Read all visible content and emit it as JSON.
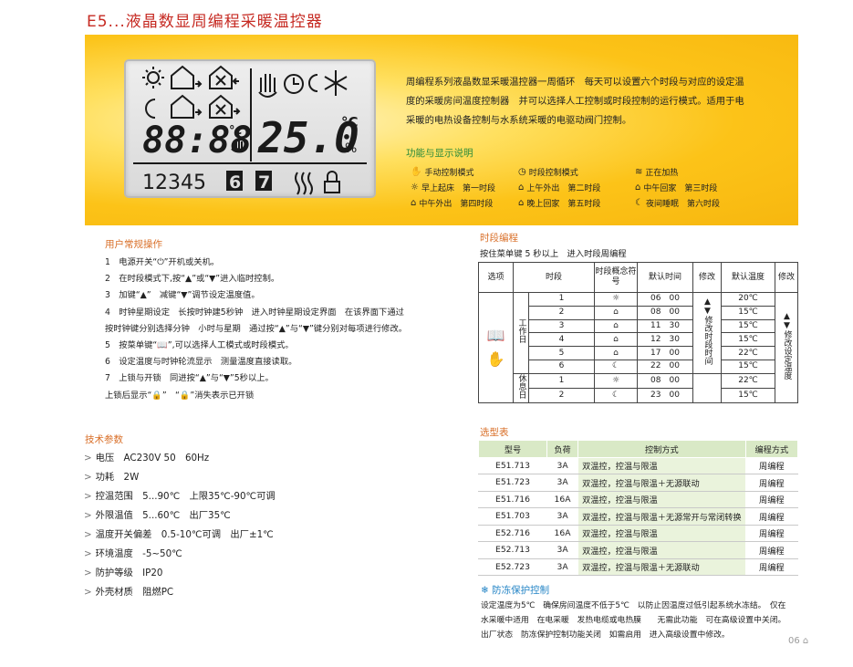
{
  "header": {
    "title": "E5...液晶数显周编程采暖温控器"
  },
  "lcd": {
    "time": "88:88",
    "time_unit": "°c",
    "temp": "25.0",
    "temp_unit": "°C",
    "percent": "%",
    "days": [
      "1",
      "2",
      "3",
      "4",
      "5",
      "6",
      "7"
    ]
  },
  "intro": {
    "text": "周编程系列液晶数显采暖温控器一周循环　每天可以设置六个时段与对应的设定温度的采暖房间温度控制器　并可以选择人工控制或时段控制的运行模式。适用于电采暖的电热设备控制与水系统采暖的电驱动阀门控制。"
  },
  "legend": {
    "heading": "功能与显示说明",
    "items": [
      {
        "icon": "✋",
        "label": "手动控制模式"
      },
      {
        "icon": "◷",
        "label": "时段控制模式"
      },
      {
        "icon": "≋",
        "label": "正在加热"
      },
      {
        "icon": "☼",
        "label": "早上起床　第一时段"
      },
      {
        "icon": "⌂",
        "label": "上午外出　第二时段"
      },
      {
        "icon": "⌂",
        "label": "中午回家　第三时段"
      },
      {
        "icon": "⌂",
        "label": "中午外出　第四时段"
      },
      {
        "icon": "⌂",
        "label": "晚上回家　第五时段"
      },
      {
        "icon": "☾",
        "label": "夜间睡眠　第六时段"
      }
    ]
  },
  "operation": {
    "heading": "用户常规操作",
    "lines": [
      "1　电源开关“⏻”开机或关机。",
      "2　在时段模式下,按“▲”或“▼”进入临时控制。",
      "3　加键“▲”　减键“▼”调节设定温度值。",
      "4　时钟星期设定　长按时钟建5秒钟　进入时钟星期设定界面　在该界面下通过",
      "按时钟键分别选择分钟　小时与星期　通过按“▲”与“▼”键分别对每项进行修改。",
      "5　按菜单键“📖”,可以选择人工模式或时段模式。",
      "6　设定温度与时钟轮流显示　测量温度直接读取。",
      "7　上锁与开锁　同进按“▲”与“▼”5秒以上。",
      "上锁后显示“🔒”　“🔒”消失表示已开锁"
    ]
  },
  "schedule": {
    "heading": "时段编程",
    "subheading": "按住菜单键 5 秒以上　进入时段周编程",
    "headers": [
      "选项",
      "时段",
      "时段概念符号",
      "默认时间",
      "修改",
      "默认温度",
      "修改"
    ],
    "workday_label": "工作日",
    "restday_label": "休息日",
    "modify_time": "▲▼修改时段时间",
    "modify_temp": "▲▼修改设定温度",
    "rows": [
      {
        "n": "1",
        "icon": "☼",
        "time": "06　00",
        "temp": "20℃"
      },
      {
        "n": "2",
        "icon": "⌂",
        "time": "08　00",
        "temp": "15℃"
      },
      {
        "n": "3",
        "icon": "⌂",
        "time": "11　30",
        "temp": "15℃"
      },
      {
        "n": "4",
        "icon": "⌂",
        "time": "12　30",
        "temp": "15℃"
      },
      {
        "n": "5",
        "icon": "⌂",
        "time": "17　00",
        "temp": "22℃"
      },
      {
        "n": "6",
        "icon": "☾",
        "time": "22　00",
        "temp": "15℃"
      },
      {
        "n": "1",
        "icon": "☼",
        "time": "08　00",
        "temp": "22℃"
      },
      {
        "n": "2",
        "icon": "☾",
        "time": "23　00",
        "temp": "15℃"
      }
    ]
  },
  "specs": {
    "heading": "技术参数",
    "items": [
      "电压　AC230V 50　60Hz",
      "功耗　2W",
      "控温范围　5...90℃　上限35℃-90℃可调",
      "外限温值　5...60℃　出厂35℃",
      "温度开关偏差　0.5-10℃可调　出厂±1℃",
      "环境温度　-5~50℃",
      "防护等级　IP20",
      "外壳材质　阻燃PC"
    ]
  },
  "models": {
    "heading": "选型表",
    "headers": [
      "型号",
      "负荷",
      "控制方式",
      "编程方式"
    ],
    "rows": [
      [
        "E51.713",
        "3A",
        "双温控，控温与限温",
        "周编程"
      ],
      [
        "E51.723",
        "3A",
        "双温控，控温与限温＋无源联动",
        "周编程"
      ],
      [
        "E51.716",
        "16A",
        "双温控，控温与限温",
        "周编程"
      ],
      [
        "E51.703",
        "3A",
        "双温控，控温与限温＋无源常开与常闭转换",
        "周编程"
      ],
      [
        "E52.716",
        "16A",
        "双温控，控温与限温",
        "周编程"
      ],
      [
        "E52.713",
        "3A",
        "双温控，控温与限温",
        "周编程"
      ],
      [
        "E52.723",
        "3A",
        "双温控，控温与限温＋无源联动",
        "周编程"
      ]
    ]
  },
  "antifreeze": {
    "heading": "防冻保护控制",
    "lines": [
      "设定温度为5℃　确保房间温度不低于5℃　以防止因温度过低引起系统水冻结。　仅在",
      "水采暖中适用　在电采暖　发热电缆或电热膜　　无需此功能　可在高级设置中关闭。",
      "出厂状态　防冻保护控制功能关闭　如需启用　进入高级设置中修改。"
    ]
  },
  "footer": {
    "page": "06"
  }
}
